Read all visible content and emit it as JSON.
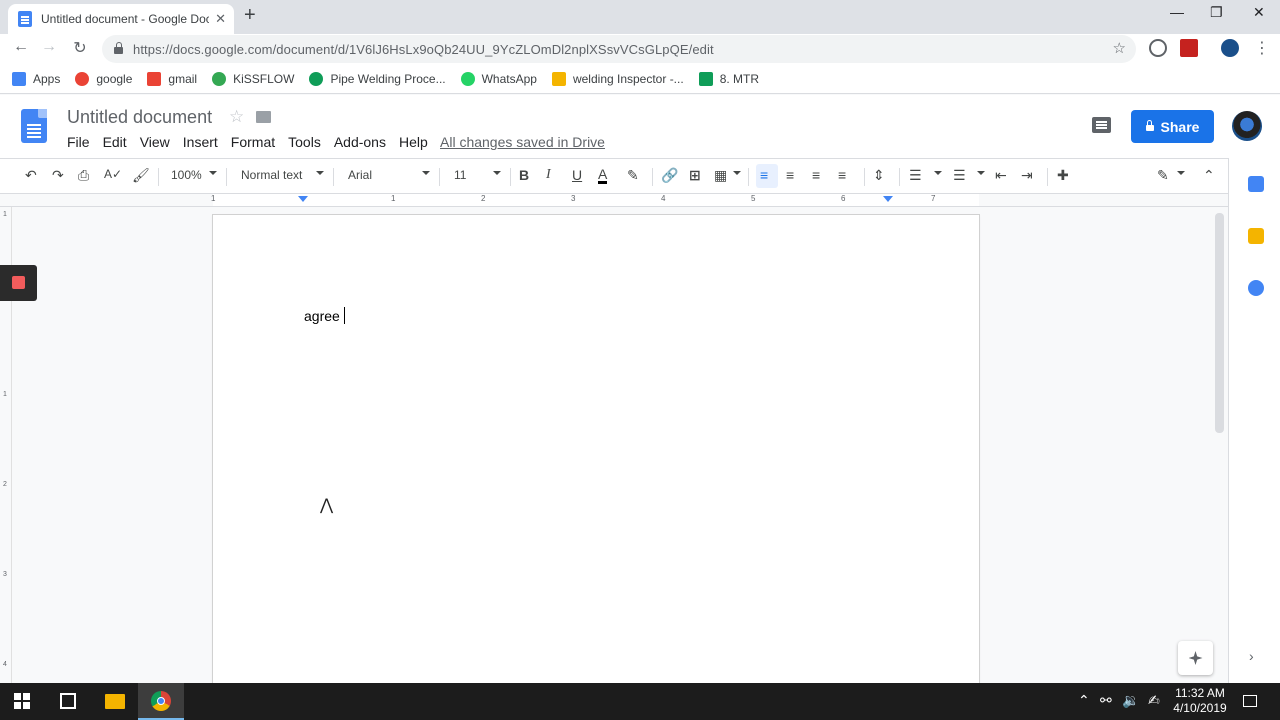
{
  "browser": {
    "tab_title": "Untitled document - Google Doc",
    "new_tab": "+",
    "url": "https://docs.google.com/document/d/1V6lJ6HsLx9oQb24UU_9YcZLOmDl2nplXSsvVCsGLpQE/edit",
    "bookmarks": [
      {
        "label": "Apps",
        "icon": "apps-grid-icon",
        "color": "#4285f4"
      },
      {
        "label": "google",
        "icon": "google-icon",
        "color": "#ea4335"
      },
      {
        "label": "gmail",
        "icon": "gmail-icon",
        "color": "#ea4335"
      },
      {
        "label": "KiSSFLOW",
        "icon": "kissflow-icon",
        "color": "#34a853"
      },
      {
        "label": "Pipe Welding Proce...",
        "icon": "pipe-welding-icon",
        "color": "#0f9d58"
      },
      {
        "label": "WhatsApp",
        "icon": "whatsapp-icon",
        "color": "#25d366"
      },
      {
        "label": "welding Inspector -...",
        "icon": "folder-icon",
        "color": "#f4b400"
      },
      {
        "label": "8. MTR",
        "icon": "sheets-icon",
        "color": "#0f9d58"
      }
    ]
  },
  "docs": {
    "title": "Untitled document",
    "menus": [
      "File",
      "Edit",
      "View",
      "Insert",
      "Format",
      "Tools",
      "Add-ons",
      "Help"
    ],
    "save_status": "All changes saved in Drive",
    "share_label": "Share",
    "toolbar": {
      "zoom": "100%",
      "style": "Normal text",
      "font": "Arial",
      "font_size": "11"
    },
    "ruler_numbers": [
      "1",
      "1",
      "2",
      "3",
      "4",
      "5",
      "6",
      "7"
    ],
    "vruler_numbers": [
      "1",
      "1",
      "2",
      "3",
      "4"
    ],
    "body_text": "agree"
  },
  "taskbar": {
    "time": "11:32 AM",
    "date": "4/10/2019"
  },
  "colors": {
    "accent": "#1a73e8",
    "docs_blue": "#4285f4",
    "record_red": "#f25c5c"
  }
}
